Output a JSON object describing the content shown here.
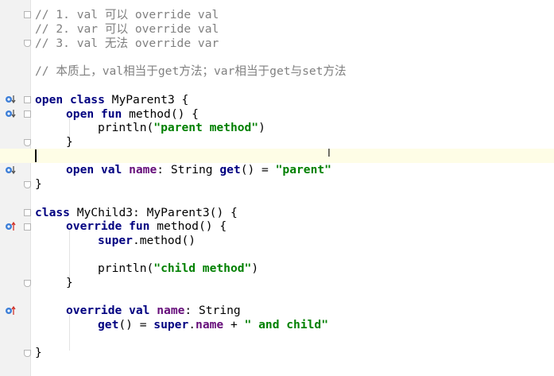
{
  "comments": [
    "// 1. val 可以 override val",
    "// 2. var 可以 override val",
    "// 3. val 无法 override var",
    "// 本质上，val相当于get方法；var相当于get与set方法"
  ],
  "code": {
    "parent": {
      "l1": {
        "kw1": "open",
        "kw2": "class",
        "rest": " MyParent3 {"
      },
      "l2": {
        "kw1": "open",
        "kw2": "fun",
        "rest": " method() {"
      },
      "l3": {
        "pre": "println(",
        "str": "\"parent method\"",
        "post": ")"
      },
      "l4": "}",
      "l5": {
        "kw1": "open",
        "kw2": "val",
        "prop": "name",
        "rest": ": String ",
        "kw3": "get",
        "rest2": "() = ",
        "str": "\"parent\""
      },
      "l6": "}"
    },
    "child": {
      "l1": {
        "kw": "class",
        "rest": " MyChild3: MyParent3() {"
      },
      "l2": {
        "kw1": "override",
        "kw2": "fun",
        "rest": " method() {"
      },
      "l3": {
        "kw": "super",
        "rest": ".method()"
      },
      "l4": {
        "pre": "println(",
        "str": "\"child method\"",
        "post": ")"
      },
      "l5": "}",
      "l6": {
        "kw1": "override",
        "kw2": "val",
        "prop": "name",
        "rest": ": String"
      },
      "l7": {
        "kw1": "get",
        "rest1": "() = ",
        "kw2": "super",
        "dot": ".",
        "prop": "name",
        "rest2": " + ",
        "str": "\" and child\""
      },
      "l8": "}"
    }
  },
  "gutter_icons": [
    "overridden-marker",
    "overridden-marker",
    "overridden-marker",
    "override-marker",
    "override-marker"
  ],
  "colors": {
    "keyword": "#000080",
    "string": "#008000",
    "property": "#660e7a",
    "comment": "#808080",
    "current_line": "#fefde6"
  }
}
